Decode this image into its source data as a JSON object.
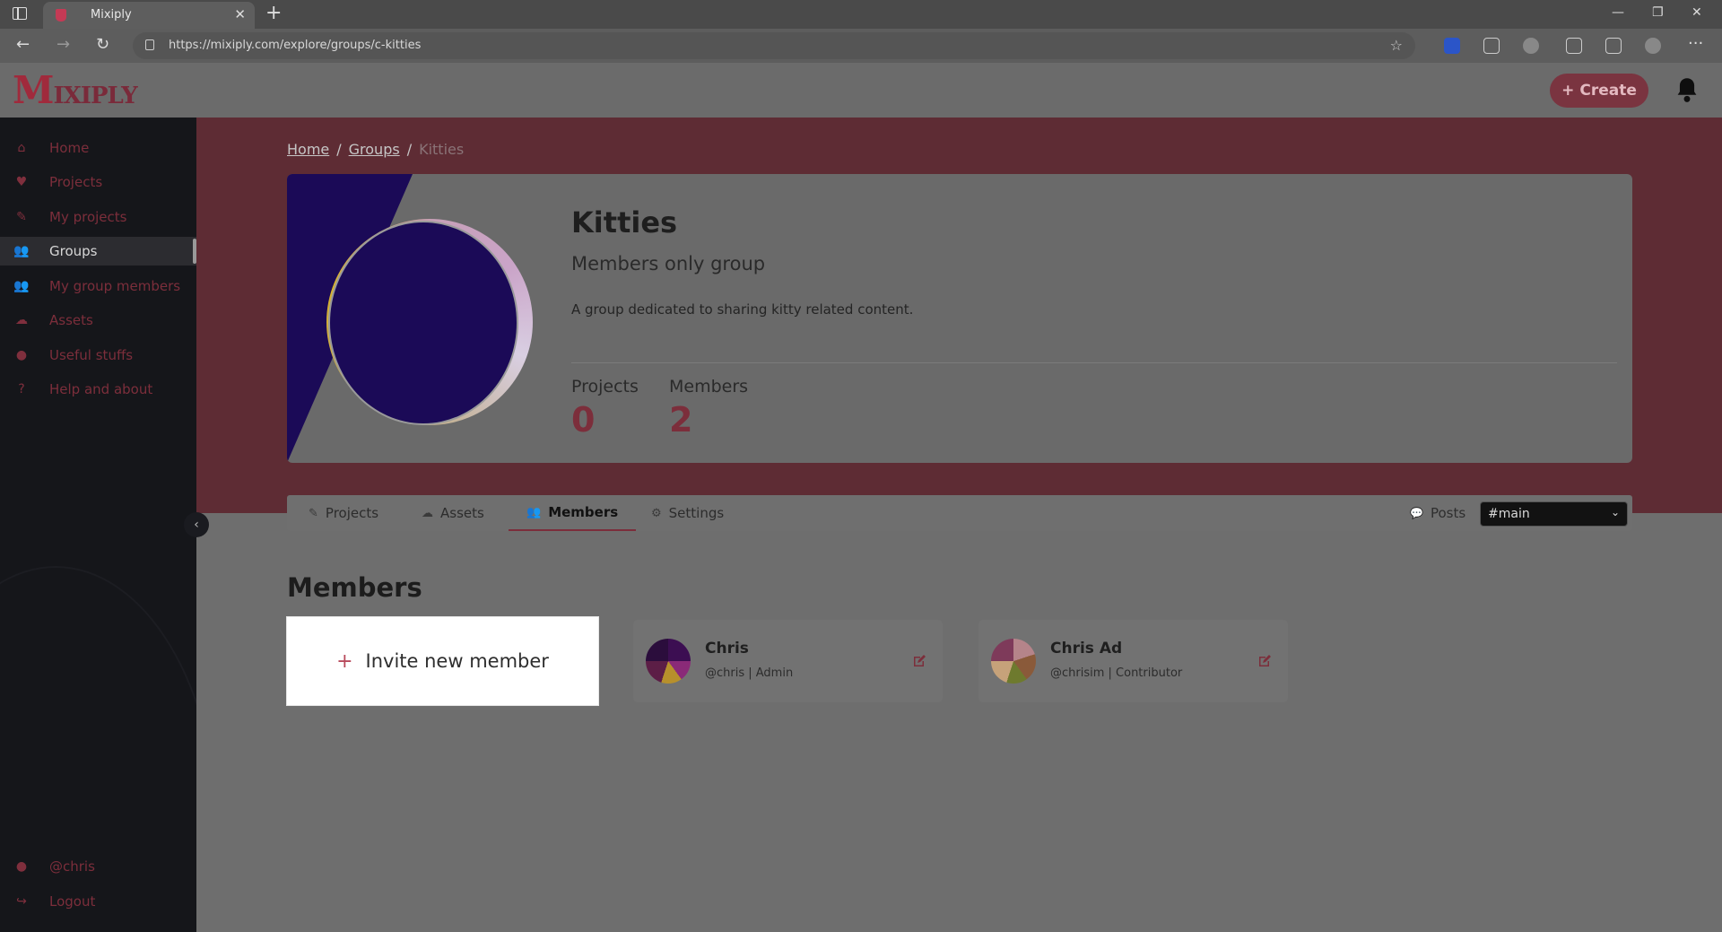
{
  "browser": {
    "tab_title": "Mixiply",
    "tab_close": "✕",
    "new_tab": "+",
    "url": "https://mixiply.com/explore/groups/c-kitties",
    "window_controls": [
      "—",
      "❐",
      "✕"
    ],
    "more": "···"
  },
  "header": {
    "logo_first": "M",
    "logo_rest": "IXIPLY",
    "create_label": "Create",
    "create_icon": "+"
  },
  "sidebar": {
    "items": [
      {
        "label": "Home",
        "icon": "home-icon",
        "glyph": "⌂"
      },
      {
        "label": "Projects",
        "icon": "heart-icon",
        "glyph": "♥"
      },
      {
        "label": "My projects",
        "icon": "brush-icon",
        "glyph": "✎"
      },
      {
        "label": "Groups",
        "icon": "users-icon",
        "glyph": "👥"
      },
      {
        "label": "My group members",
        "icon": "user-group-icon",
        "glyph": "👥"
      },
      {
        "label": "Assets",
        "icon": "cloud-icon",
        "glyph": "☁"
      },
      {
        "label": "Useful stuffs",
        "icon": "lightbulb-icon",
        "glyph": "●"
      },
      {
        "label": "Help and about",
        "icon": "question-icon",
        "glyph": "?"
      }
    ],
    "user": {
      "label": "@chris",
      "glyph": "●"
    },
    "logout": {
      "label": "Logout",
      "glyph": "↪"
    },
    "collapse_glyph": "‹"
  },
  "breadcrumb": {
    "home": "Home",
    "sep1": "/",
    "groups": "Groups",
    "sep2": "/",
    "current": "Kitties"
  },
  "group": {
    "title": "Kitties",
    "subtitle": "Members only group",
    "description": "A group dedicated to sharing kitty related content.",
    "stats": {
      "projects_label": "Projects",
      "projects_value": "0",
      "members_label": "Members",
      "members_value": "2"
    }
  },
  "tabs": [
    {
      "label": "Projects",
      "glyph": "✎"
    },
    {
      "label": "Assets",
      "glyph": "☁"
    },
    {
      "label": "Members",
      "glyph": "👥"
    },
    {
      "label": "Settings",
      "glyph": "⚙"
    }
  ],
  "posts": {
    "label": "Posts",
    "glyph": "💬",
    "channel": "#main",
    "chevron": "⌄"
  },
  "members_section": {
    "title": "Members",
    "invite_label": "Invite new member",
    "invite_icon": "+",
    "members": [
      {
        "name": "Chris",
        "meta": "@chris | Admin"
      },
      {
        "name": "Chris Ad",
        "meta": "@chrisim | Contributor"
      }
    ]
  },
  "colors": {
    "accent": "#7c2e3b",
    "hero_bg": "#5e2c34",
    "sidebar_bg": "#15161a"
  }
}
